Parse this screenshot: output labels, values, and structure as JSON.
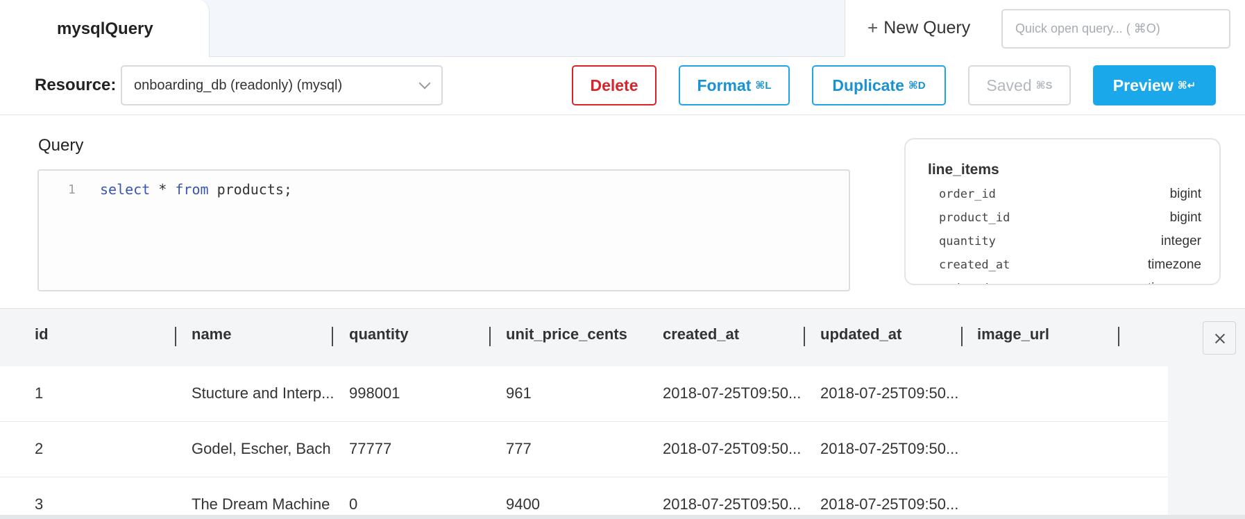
{
  "tabs": {
    "active_label": "mysqlQuery"
  },
  "header": {
    "new_query_label": "New Query",
    "quick_open_placeholder": "Quick open query... ( ⌘O)"
  },
  "toolbar": {
    "resource_label": "Resource:",
    "resource_value": "onboarding_db (readonly) (mysql)",
    "delete_label": "Delete",
    "format_label": "Format",
    "format_shortcut": "⌘L",
    "duplicate_label": "Duplicate",
    "duplicate_shortcut": "⌘D",
    "saved_label": "Saved",
    "saved_shortcut": "⌘S",
    "preview_label": "Preview",
    "preview_shortcut": "⌘↵"
  },
  "query": {
    "label": "Query",
    "line_number": "1",
    "code_kw1": "select",
    "code_mid": " * ",
    "code_kw2": "from",
    "code_tail": " products;"
  },
  "schema": {
    "table_name": "line_items",
    "columns": [
      {
        "name": "order_id",
        "type": "bigint"
      },
      {
        "name": "product_id",
        "type": "bigint"
      },
      {
        "name": "quantity",
        "type": "integer"
      },
      {
        "name": "created_at",
        "type": "timezone"
      },
      {
        "name": "updated_at",
        "type": "timezone"
      }
    ]
  },
  "results": {
    "headers": [
      "id",
      "name",
      "quantity",
      "unit_price_cents",
      "created_at",
      "updated_at",
      "image_url"
    ],
    "rows": [
      [
        "1",
        "Stucture and Interp...",
        "998001",
        "961",
        "2018-07-25T09:50...",
        "2018-07-25T09:50...",
        ""
      ],
      [
        "2",
        "Godel, Escher, Bach",
        "77777",
        "777",
        "2018-07-25T09:50...",
        "2018-07-25T09:50...",
        ""
      ],
      [
        "3",
        "The Dream Machine",
        "0",
        "9400",
        "2018-07-25T09:50...",
        "2018-07-25T09:50...",
        ""
      ]
    ]
  }
}
